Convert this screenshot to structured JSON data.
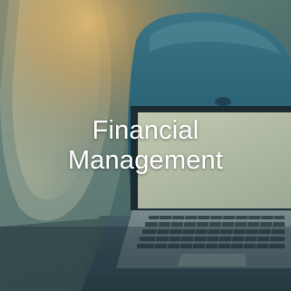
{
  "tile": {
    "title_line1": "Financial",
    "title_line2": "Management",
    "icon": "laptop-on-airplane-seat-photo"
  },
  "colors": {
    "text": "#ffffff",
    "tint": "#2f5a55",
    "warm_glow": "#e0a24a",
    "seat": "#2e6f86",
    "laptop_body": "#8a9a98",
    "screen": "#c9d3b8"
  }
}
